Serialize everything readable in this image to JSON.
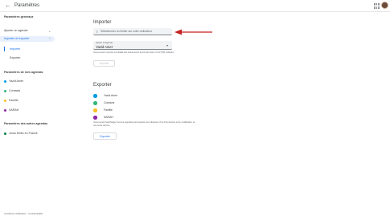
{
  "header": {
    "back_icon": "arrow-back-icon",
    "title": "Paramètres",
    "apps_icon": "apps-grid-icon"
  },
  "sidebar": {
    "general_title": "Paramètres généraux",
    "items": [
      {
        "label": "Ajouter un agenda",
        "expanded": false
      },
      {
        "label": "Importer et exporter",
        "expanded": true
      }
    ],
    "subitems": [
      {
        "label": "Importer",
        "selected": true
      },
      {
        "label": "Exporter",
        "selected": false
      }
    ],
    "my_calendars_title": "Paramètres de mes agendas",
    "my_calendars": [
      {
        "label": "Yazid Amer",
        "color": "#039be5"
      },
      {
        "label": "Contacts",
        "color": "#33b679"
      },
      {
        "label": "Famille",
        "color": "#f6bf26"
      },
      {
        "label": "SARAH",
        "color": "#8e24aa"
      }
    ],
    "other_calendars_title": "Paramètres des autres agendas",
    "other_calendars": [
      {
        "label": "Jours fériés en France",
        "color": "#0b8043"
      }
    ]
  },
  "import": {
    "heading": "Importer",
    "file_button_label": "Sélectionner un fichier sur votre ordinateur",
    "file_icon": "upload-icon",
    "calendar_select_label": "Ajouter à l'agenda",
    "calendar_select_value": "Yazid Amer",
    "hint": "Vous pouvez importer les détails des événements au format iCal ou CSV (MS Outlook).",
    "button_label": "Importer",
    "arrow_color": "#c5221f"
  },
  "export": {
    "heading": "Exporter",
    "calendars": [
      {
        "label": "Yazid Amer",
        "color": "#039be5"
      },
      {
        "label": "Contacts",
        "color": "#33b679"
      },
      {
        "label": "Famille",
        "color": "#f6bf26"
      },
      {
        "label": "SARAH",
        "color": "#8e24aa"
      }
    ],
    "hint_line1": "Vous pouvez télécharger tous les agendas que lesquels vous disposez d'un droit d'accès et de modification en",
    "hint_line2": "une seule archive.",
    "button_label": "Exporter"
  },
  "footer": {
    "text": "Conditions d'utilisation - Confidentialité"
  },
  "colors": {
    "accent": "#1a73e8",
    "nav_active_bg": "#e8f0fe"
  }
}
